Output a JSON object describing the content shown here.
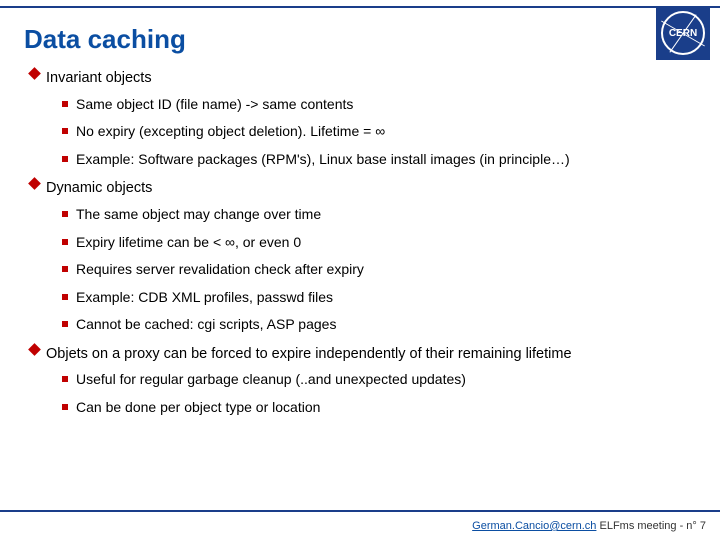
{
  "logo_text": "CERN",
  "title": "Data caching",
  "sections": [
    {
      "heading": "Invariant objects",
      "items": [
        "Same object ID (file name) -> same contents",
        "No expiry (excepting object deletion). Lifetime = ∞",
        "Example: Software packages (RPM's), Linux base install images (in principle…)"
      ]
    },
    {
      "heading": "Dynamic objects",
      "items": [
        "The same object may change over time",
        "Expiry lifetime can be < ∞, or even 0",
        "Requires server revalidation check after expiry",
        "Example: CDB XML profiles, passwd files",
        "Cannot be cached: cgi scripts, ASP pages"
      ]
    },
    {
      "heading": "Objets on a proxy can be forced to expire independently of their remaining lifetime",
      "items": [
        "Useful for regular garbage cleanup (..and unexpected updates)",
        "Can be done per object type or location"
      ]
    }
  ],
  "footer": {
    "email": "German.Cancio@cern.ch",
    "rest": " ELFms meeting - n° 7"
  }
}
